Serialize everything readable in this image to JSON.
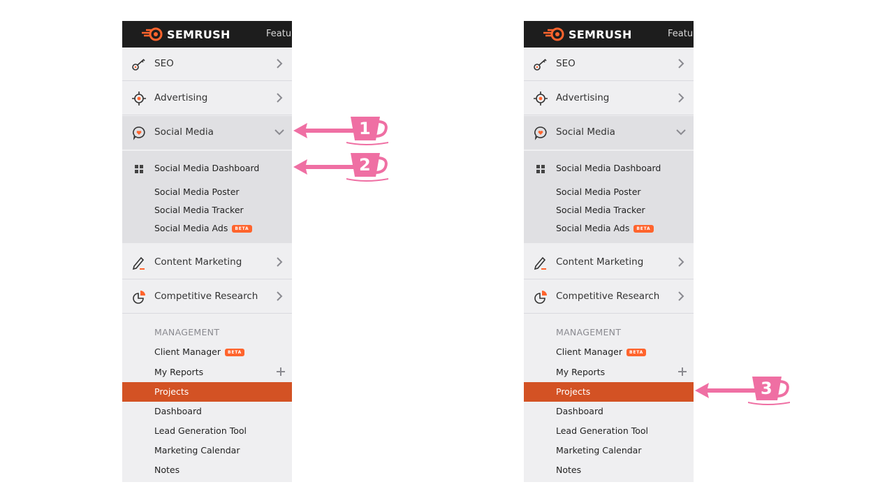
{
  "header": {
    "brand": "SEMRUSH",
    "features_label": "Featu"
  },
  "nav": [
    {
      "label": "SEO",
      "icon": "seo-key-icon"
    },
    {
      "label": "Advertising",
      "icon": "target-icon"
    },
    {
      "label": "Social Media",
      "icon": "speech-bubble-heart-icon",
      "expanded": true
    },
    {
      "label": "Content Marketing",
      "icon": "pencil-icon"
    },
    {
      "label": "Competitive Research",
      "icon": "pie-chart-icon"
    }
  ],
  "social_submenu": [
    {
      "label": "Social Media Dashboard",
      "icon": "grid-icon"
    },
    {
      "label": "Social Media Poster"
    },
    {
      "label": "Social Media Tracker"
    },
    {
      "label": "Social Media Ads",
      "badge": "BETA"
    }
  ],
  "management": {
    "heading": "MANAGEMENT",
    "items": [
      {
        "label": "Client Manager",
        "badge": "BETA"
      },
      {
        "label": "My Reports",
        "action": "plus-icon"
      },
      {
        "label": "Projects",
        "active": true
      },
      {
        "label": "Dashboard"
      },
      {
        "label": "Lead Generation Tool"
      },
      {
        "label": "Marketing Calendar"
      },
      {
        "label": "Notes"
      }
    ]
  },
  "callouts": [
    "1",
    "2",
    "3"
  ],
  "colors": {
    "accent": "#ff642d",
    "active_bg": "#d35224",
    "callout": "#ef6fa3",
    "header_bg": "#1d1d1d"
  }
}
